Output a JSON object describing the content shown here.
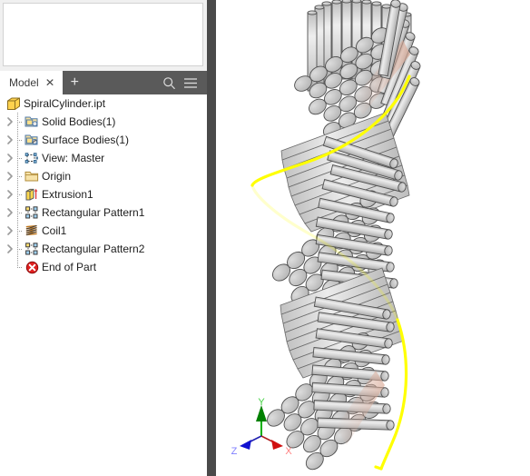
{
  "window": {
    "app": "cad-modeler",
    "viewport_background": "#ffffff"
  },
  "upper_panel": {
    "name": "empty-properties-panel",
    "content": ""
  },
  "tab_bar": {
    "background": "#5a5a5a",
    "active_tab": {
      "label": "Model",
      "close_label": "✕"
    },
    "add_tab_label": "+",
    "tools": [
      {
        "icon": "search-icon",
        "label": "Search"
      },
      {
        "icon": "hamburger-menu-icon",
        "label": "Menu"
      }
    ]
  },
  "browser_tree": {
    "rows": [
      {
        "label": "SpiralCylinder.ipt",
        "icon": "part-document-icon",
        "level": 0,
        "expandable": false,
        "last": false
      },
      {
        "label": "Solid Bodies(1)",
        "icon": "solid-bodies-folder-icon",
        "level": 1,
        "expandable": true,
        "last": false
      },
      {
        "label": "Surface Bodies(1)",
        "icon": "surface-bodies-folder-icon",
        "level": 1,
        "expandable": true,
        "last": false
      },
      {
        "label": "View: Master",
        "icon": "view-master-icon",
        "level": 1,
        "expandable": true,
        "last": false
      },
      {
        "label": "Origin",
        "icon": "origin-folder-icon",
        "level": 1,
        "expandable": true,
        "last": false
      },
      {
        "label": "Extrusion1",
        "icon": "extrusion-icon",
        "level": 1,
        "expandable": true,
        "last": false
      },
      {
        "label": "Rectangular Pattern1",
        "icon": "rectangular-pattern-icon",
        "level": 1,
        "expandable": true,
        "last": false
      },
      {
        "label": "Coil1",
        "icon": "coil-icon",
        "level": 1,
        "expandable": true,
        "last": false
      },
      {
        "label": "Rectangular Pattern2",
        "icon": "rectangular-pattern-icon",
        "level": 1,
        "expandable": true,
        "last": false
      },
      {
        "label": "End of Part",
        "icon": "end-of-part-icon",
        "level": 1,
        "expandable": false,
        "last": true
      }
    ]
  },
  "viewport": {
    "model_name": "SpiralCylinder",
    "model_description": "twisted spiral array of cylindrical rods",
    "body_fill": "#c9c9c9",
    "body_edge": "#4d4d4d",
    "highlight_color": "#ffff00",
    "highlight_description": "selected helical coil path"
  },
  "axis_triad": {
    "axes": [
      {
        "label": "Y",
        "color": "#00a000"
      },
      {
        "label": "X",
        "color": "#ff4040"
      },
      {
        "label": "Z",
        "color": "#4040ff"
      }
    ]
  }
}
